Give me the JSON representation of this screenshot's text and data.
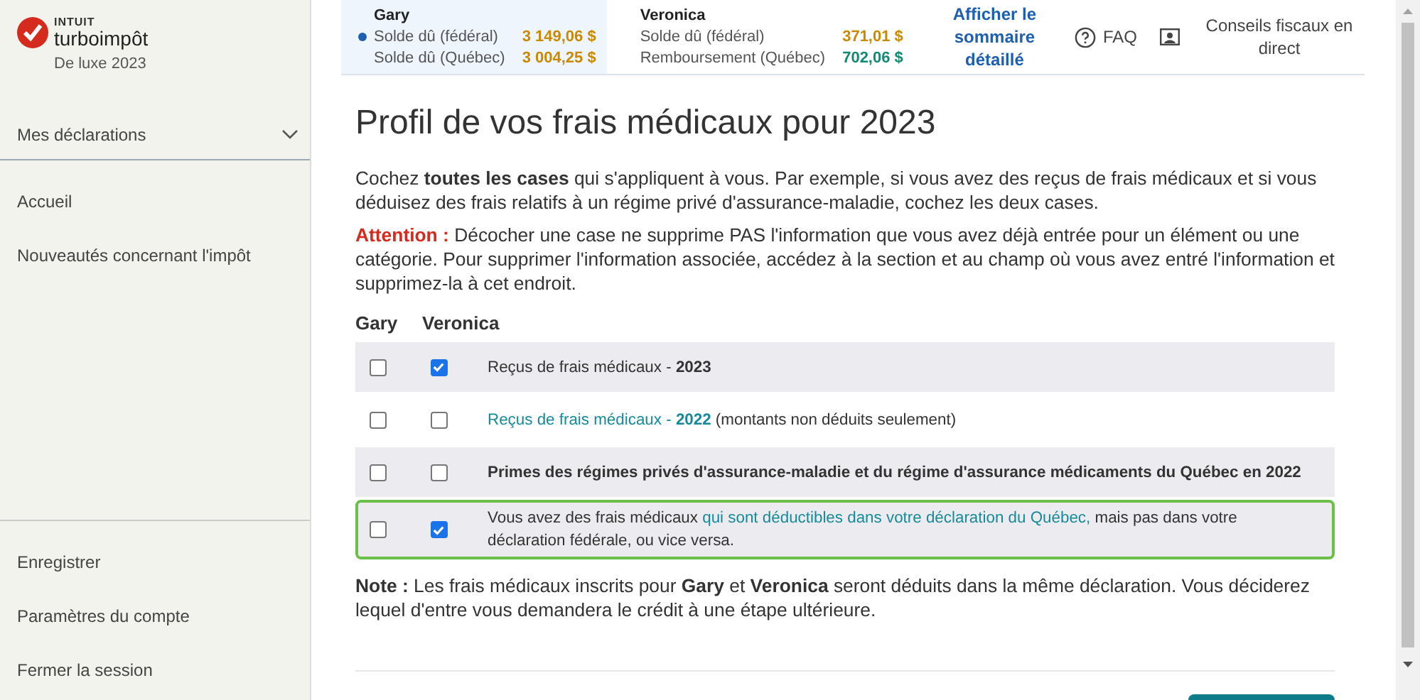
{
  "brand": {
    "company": "INTUIT",
    "product": "turboimpôt",
    "edition": "De luxe 2023"
  },
  "sidebar": {
    "section": {
      "label": "Mes déclarations",
      "expanded": false
    },
    "items": [
      {
        "label": "Accueil"
      },
      {
        "label": "Nouveautés concernant l'impôt"
      }
    ],
    "footer_items": [
      {
        "label": "Enregistrer"
      },
      {
        "label": "Paramètres du compte"
      },
      {
        "label": "Fermer la session"
      }
    ]
  },
  "header": {
    "people": [
      {
        "name": "Gary",
        "selected": true,
        "lines": [
          {
            "label": "Solde dû (fédéral)",
            "amount": "3 149,06 $",
            "kind": "owing"
          },
          {
            "label": "Solde dû (Québec)",
            "amount": "3 004,25 $",
            "kind": "owing"
          }
        ]
      },
      {
        "name": "Veronica",
        "selected": false,
        "lines": [
          {
            "label": "Solde dû (fédéral)",
            "amount": "371,01 $",
            "kind": "owing"
          },
          {
            "label": "Remboursement (Québec)",
            "amount": "702,06 $",
            "kind": "refund"
          }
        ]
      }
    ],
    "summary_link": "Afficher le sommaire détaillé",
    "faq": "FAQ",
    "live_help": "Conseils fiscaux en direct"
  },
  "page": {
    "title": "Profil de vos frais médicaux pour 2023",
    "intro": "Cochez **toutes les cases** qui s'appliquent à vous. Par exemple, si vous avez des reçus de frais médicaux et si vous déduisez des frais relatifs à un régime privé d'assurance-maladie, cochez les deux cases.",
    "warning_label": "Attention :",
    "warning": "Décocher une case ne supprime PAS l'information que vous avez déjà entrée pour un élément ou une catégorie. Pour supprimer l'information associée, accédez à la section et au champ où vous avez entré l'information et supprimez-la à cet endroit.",
    "columns": [
      "Gary",
      "Veronica"
    ],
    "rows": [
      {
        "checks": [
          {
            "checked": false
          },
          {
            "checked": true
          }
        ],
        "bold": false,
        "highlighted": false,
        "parts": [
          {
            "kind": "plain",
            "text": "Reçus de frais médicaux - **2023**"
          }
        ]
      },
      {
        "checks": [
          {
            "checked": false
          },
          {
            "checked": false
          }
        ],
        "bold": false,
        "highlighted": false,
        "parts": [
          {
            "kind": "link",
            "text": "Reçus de frais médicaux - **2022**"
          },
          {
            "kind": "plain",
            "text": " (montants non déduits seulement)"
          }
        ]
      },
      {
        "checks": [
          {
            "checked": false
          },
          {
            "checked": false
          }
        ],
        "bold": true,
        "highlighted": false,
        "parts": [
          {
            "kind": "plain",
            "text": "Primes des régimes privés d'assurance-maladie et du régime d'assurance médicaments du Québec en 2022"
          }
        ]
      },
      {
        "checks": [
          {
            "checked": false
          },
          {
            "checked": true
          }
        ],
        "bold": false,
        "highlighted": true,
        "parts": [
          {
            "kind": "plain",
            "text": "Vous avez des frais médicaux "
          },
          {
            "kind": "link",
            "text": "qui sont déductibles dans votre déclaration du Québec,"
          },
          {
            "kind": "plain",
            "text": " mais pas dans votre déclaration fédérale, ou vice versa."
          }
        ]
      }
    ],
    "note": "**Note :** Les frais médicaux inscrits pour **Gary** et **Veronica** seront déduits dans la même déclaration. Vous déciderez lequel d'entre vous demandera le crédit à une étape ultérieure."
  }
}
